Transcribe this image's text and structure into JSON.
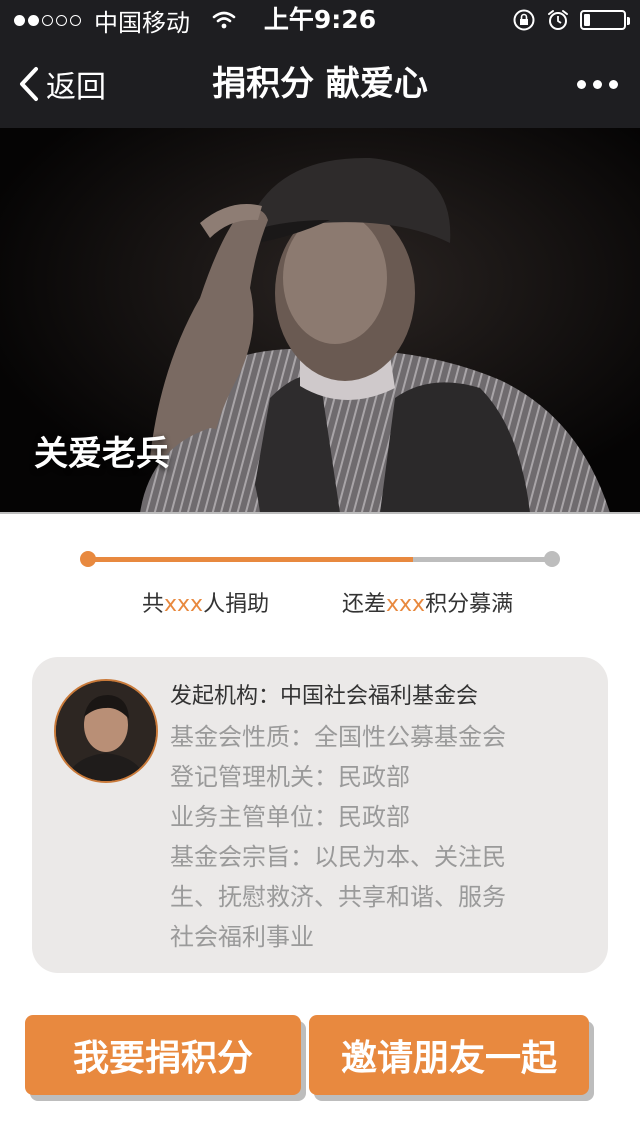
{
  "status_bar": {
    "signal_icon": "signal-dots-icon",
    "carrier": "中国移动",
    "wifi_icon": "wifi-icon",
    "time": "上午9:26",
    "lock_icon": "rotation-lock-icon",
    "alarm_icon": "alarm-clock-icon",
    "battery_icon": "battery-icon",
    "battery_level": 0.15
  },
  "nav": {
    "back_label": "返回",
    "title": "捐积分 献爱心",
    "more_icon": "more-dots-icon"
  },
  "hero": {
    "caption": "关爱老兵"
  },
  "progress": {
    "fraction": 0.7
  },
  "stats": {
    "donors_prefix": "共",
    "donors_value": "xxx",
    "donors_suffix": "人捐助",
    "remaining_prefix": "还差",
    "remaining_value": "xxx",
    "remaining_suffix": "积分募满"
  },
  "org": {
    "lines": [
      "发起机构：中国社会福利基金会",
      "基金会性质：全国性公募基金会",
      "登记管理机关：民政部",
      "业务主管单位：民政部",
      "基金会宗旨：以民为本、关注民",
      "生、抚慰救济、共享和谐、服务",
      "社会福利事业"
    ]
  },
  "buttons": {
    "donate": "我要捐积分",
    "invite": "邀请朋友一起"
  },
  "colors": {
    "accent": "#e8893f",
    "bar_bg": "#1e1e21",
    "track": "#bdbdbd",
    "card_bg": "#ebe9e8"
  }
}
